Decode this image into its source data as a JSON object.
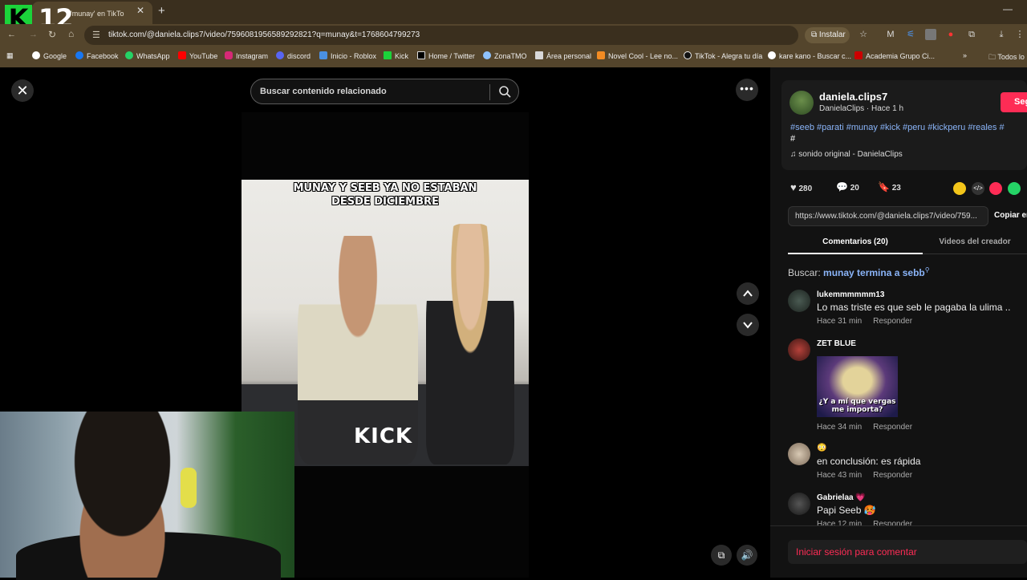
{
  "overlay": {
    "stream_number": "12",
    "kick_logo_letter": "K"
  },
  "browser": {
    "tab_title": "'munay' en TikTo",
    "url": "tiktok.com/@daniela.clips7/video/7596081956589292821?q=munay&t=1768604799273",
    "install_label": "Instalar",
    "bookmarks": [
      "Google",
      "Facebook",
      "WhatsApp",
      "YouTube",
      "Instagram",
      "discord",
      "Inicio - Roblox",
      "Kick",
      "Home / Twitter",
      "ZonaTMO",
      "Área personal",
      "Novel Cool - Lee no...",
      "TikTok - Alegra tu día",
      "kare kano - Buscar c...",
      "Academia Grupo Ci...",
      "Todos lo"
    ]
  },
  "viewer": {
    "search_placeholder": "Buscar contenido relacionado",
    "more_label": "•••",
    "video_caption": "MUNAY Y SEEB YA NO ESTABAN\nDESDE DICIEMBRE",
    "watermark": "KICK"
  },
  "post": {
    "username": "daniela.clips7",
    "subline": "DanielaClips · Hace 1 h",
    "follow_label": "Seg",
    "hashtags": "#seeb #parati #munay #kick #peru #kickperu #reales #",
    "hashtags_line2": "#",
    "music": "sonido original - DanielaClips",
    "likes": "280",
    "comments": "20",
    "saves": "23",
    "link": "https://www.tiktok.com/@daniela.clips7/video/759...",
    "copy_label": "Copiar en",
    "tab_comments": "Comentarios (20)",
    "tab_creator": "Videos del creador",
    "search_label": "Buscar:",
    "search_term": "munay termina a sebb"
  },
  "comments": [
    {
      "name": "lukemmmmmm13",
      "text": "Lo mas triste es que seb le pagaba la ulima ..",
      "time": "Hace 31 min",
      "reply": "Responder"
    },
    {
      "name": "ZET BLUE",
      "sticker_text": "¿Y a mí que vergas\nme importa?",
      "time": "Hace 34 min",
      "reply": "Responder"
    },
    {
      "name": "😳",
      "text": "en conclusión: es rápida",
      "time": "Hace 43 min",
      "reply": "Responder"
    },
    {
      "name": "Gabrielaa 💗",
      "text": "Papi Seeb 🥵",
      "time": "Hace 12 min",
      "reply": "Responder"
    }
  ],
  "login_prompt": "Iniciar sesión para comentar",
  "colors": {
    "accent": "#fe2c55",
    "link": "#8ab4f8",
    "kick_green": "#1bd33a"
  }
}
